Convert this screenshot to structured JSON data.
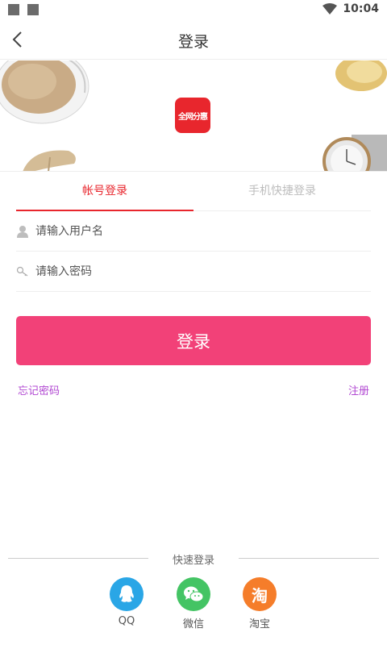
{
  "status_bar": {
    "time": "10:04"
  },
  "navbar": {
    "title": "登录",
    "back_icon": "chevron-left-icon"
  },
  "banner": {
    "logo_text": "全网分惠"
  },
  "tabs": {
    "account_label": "帐号登录",
    "phone_label": "手机快捷登录",
    "active": "account"
  },
  "form": {
    "username_placeholder": "请输入用户名",
    "password_placeholder": "请输入密码",
    "login_label": "登录"
  },
  "links": {
    "forgot": "忘记密码",
    "register": "注册"
  },
  "quick_login": {
    "title": "快速登录",
    "providers": [
      {
        "name": "QQ",
        "color": "#2aa6e6",
        "icon": "qq-icon"
      },
      {
        "name": "微信",
        "color": "#44c464",
        "icon": "wechat-icon"
      },
      {
        "name": "淘宝",
        "color": "#f57d2a",
        "icon": "taobao-icon",
        "glyph": "淘"
      }
    ]
  },
  "colors": {
    "accent": "#e8262d",
    "button": "#f24178",
    "link": "#b148d2"
  }
}
